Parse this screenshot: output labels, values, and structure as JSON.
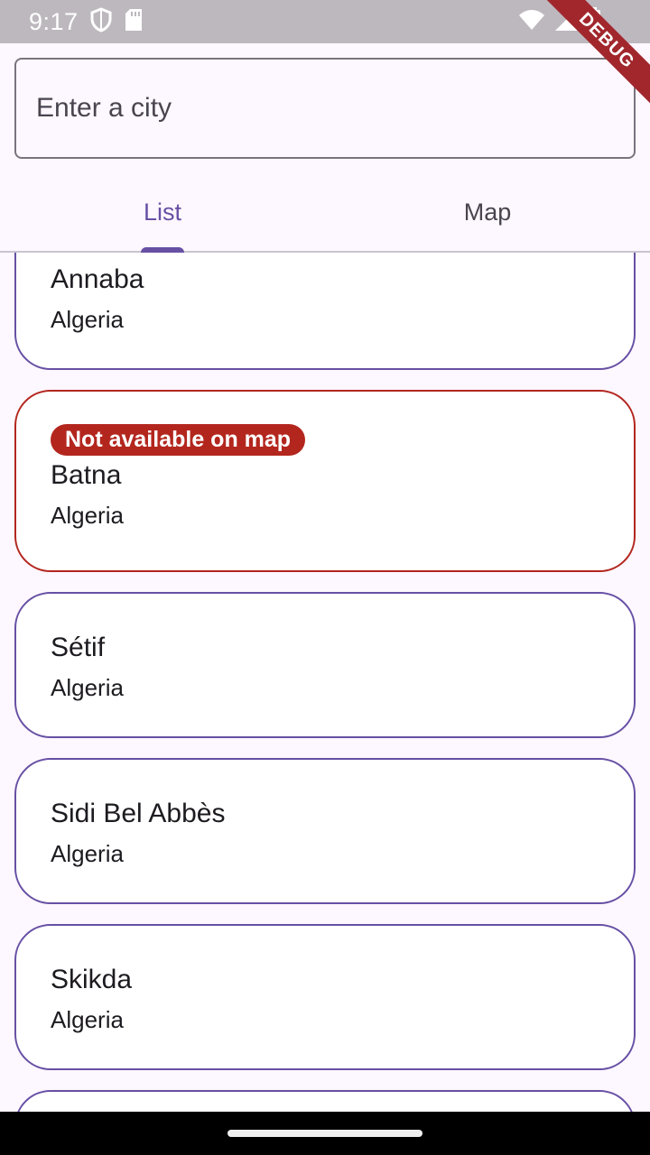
{
  "status_bar": {
    "time": "9:17",
    "icons_left": [
      "shield-icon",
      "sd-card-icon"
    ],
    "icons_right": [
      "wifi-icon",
      "signal-icon",
      "battery-icon"
    ]
  },
  "debug_banner": "DEBUG",
  "search": {
    "placeholder": "Enter a city",
    "value": ""
  },
  "tabs": [
    {
      "label": "List",
      "active": true
    },
    {
      "label": "Map",
      "active": false
    }
  ],
  "cities": [
    {
      "name": "Annaba",
      "country": "Algeria",
      "badge": null
    },
    {
      "name": "Batna",
      "country": "Algeria",
      "badge": "Not available on map"
    },
    {
      "name": "Sétif",
      "country": "Algeria",
      "badge": null
    },
    {
      "name": "Sidi Bel Abbès",
      "country": "Algeria",
      "badge": null
    },
    {
      "name": "Skikda",
      "country": "Algeria",
      "badge": null
    }
  ],
  "colors": {
    "primary": "#6750a4",
    "error": "#b3261e",
    "background": "#fdf7ff",
    "status_bar": "#bdb8be"
  }
}
